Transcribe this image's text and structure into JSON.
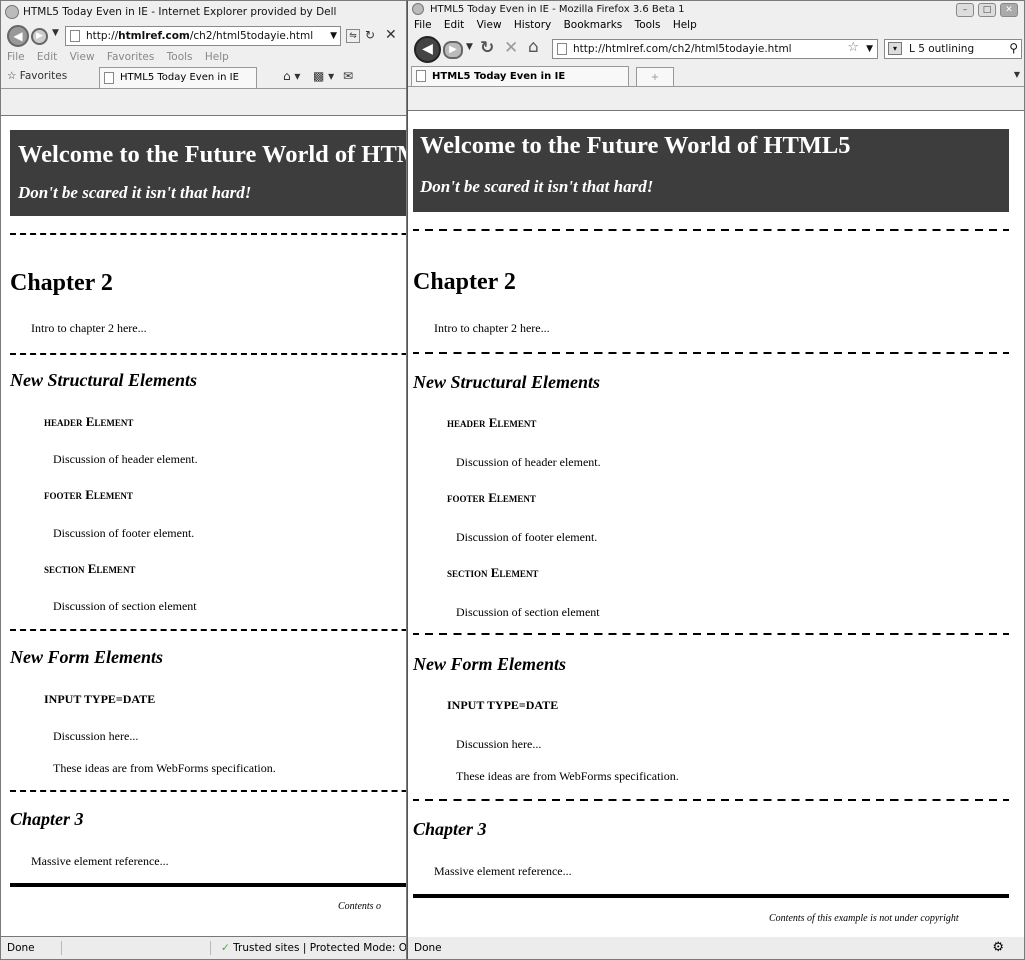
{
  "ie": {
    "title": "HTML5 Today Even in IE - Internet Explorer provided by Dell",
    "url_prefix": "http://",
    "url_host": "htmlref.com",
    "url_path": "/ch2/html5todayie.html",
    "menu": [
      "File",
      "Edit",
      "View",
      "Favorites",
      "Tools",
      "Help"
    ],
    "favorites_label": "Favorites",
    "tab_label": "HTML5 Today Even in IE",
    "status_left": "Done",
    "status_right": "Trusted sites | Protected Mode: Off"
  },
  "ff": {
    "title": "HTML5 Today Even in IE - Mozilla Firefox 3.6 Beta 1",
    "menu": [
      "File",
      "Edit",
      "View",
      "History",
      "Bookmarks",
      "Tools",
      "Help"
    ],
    "url": "http://htmlref.com/ch2/html5todayie.html",
    "search_text": "L 5 outlining",
    "tab_label": "HTML5 Today Even in IE",
    "new_tab": "+",
    "status_left": "Done"
  },
  "page": {
    "header_title": "Welcome to the Future World of HTML5",
    "header_subtitle": "Don't be scared it isn't that hard!",
    "chapter2": "Chapter 2",
    "chapter2_intro": "Intro to chapter 2 here...",
    "section1": "New Structural Elements",
    "header_el": "header Element",
    "header_el_desc": "Discussion of header element.",
    "footer_el": "footer Element",
    "footer_el_desc": "Discussion of footer element.",
    "section_el": "section Element",
    "section_el_desc": "Discussion of section element",
    "section2": "New Form Elements",
    "input_date": "INPUT TYPE=DATE",
    "input_desc": "Discussion here...",
    "input_note": "These ideas are from WebForms specification.",
    "chapter3": "Chapter 3",
    "chapter3_desc": "Massive element reference...",
    "footer_note": "Contents of this example is not under copyright",
    "footer_note_ie": "Contents o"
  }
}
